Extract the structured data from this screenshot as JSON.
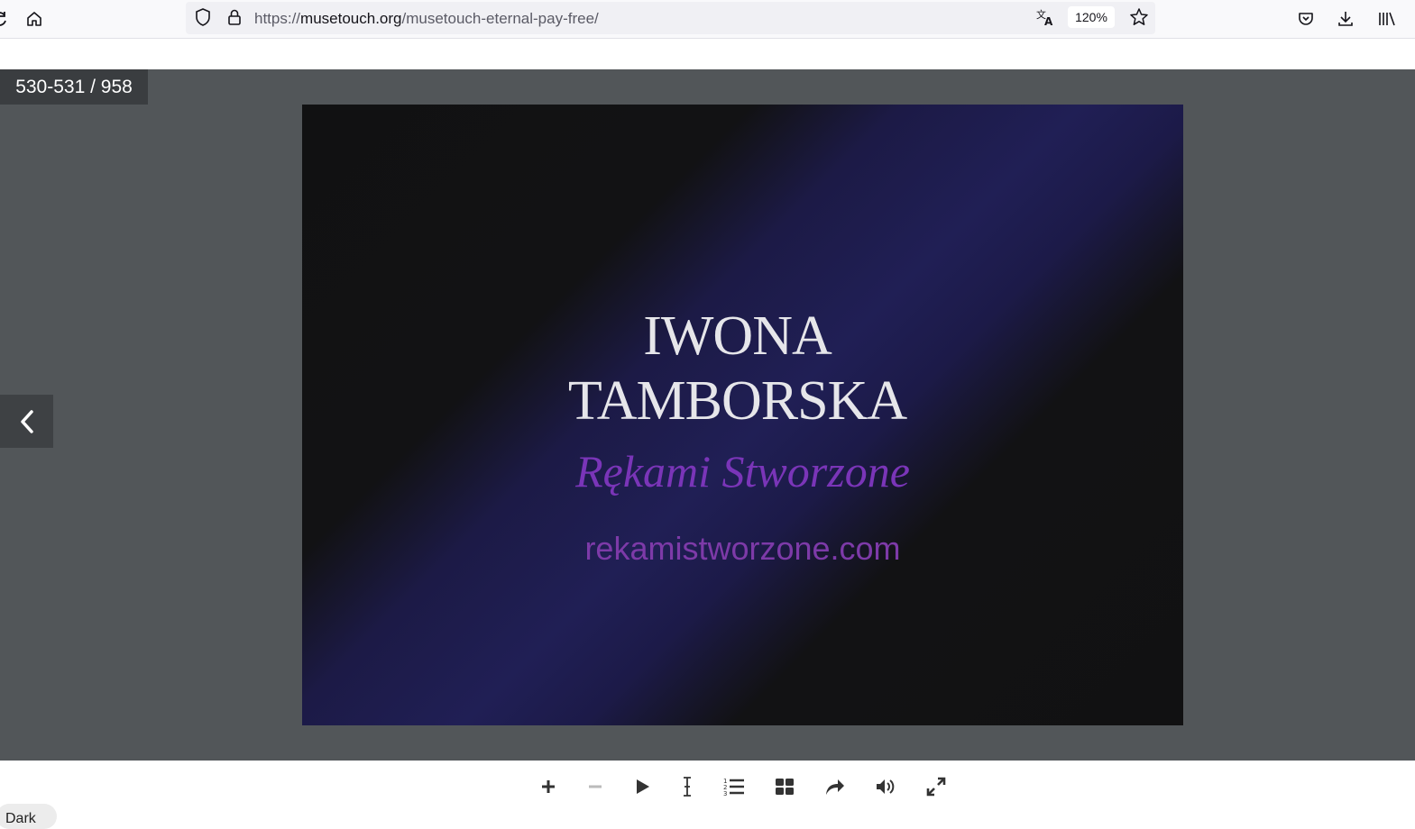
{
  "browser": {
    "url_prefix": "https://",
    "url_domain": "musetouch.org",
    "url_path": "/musetouch-eternal-pay-free/",
    "zoom": "120%"
  },
  "viewer": {
    "page_counter": "530-531 / 958"
  },
  "slide": {
    "title_line1": "IWONA",
    "title_line2": "TAMBORSKA",
    "subtitle": "Rękami Stworzone",
    "website": "rekamistworzone.com"
  },
  "footer": {
    "dark_label": "Dark"
  },
  "icons": [
    "reload-icon",
    "home-icon",
    "shield-icon",
    "lock-icon",
    "translate-icon",
    "star-icon",
    "pocket-icon",
    "download-icon",
    "library-icon",
    "chevron-left-icon",
    "zoom-in-icon",
    "zoom-out-icon",
    "play-icon",
    "text-select-icon",
    "toc-icon",
    "thumbnails-icon",
    "share-icon",
    "sound-icon",
    "fullscreen-icon"
  ]
}
